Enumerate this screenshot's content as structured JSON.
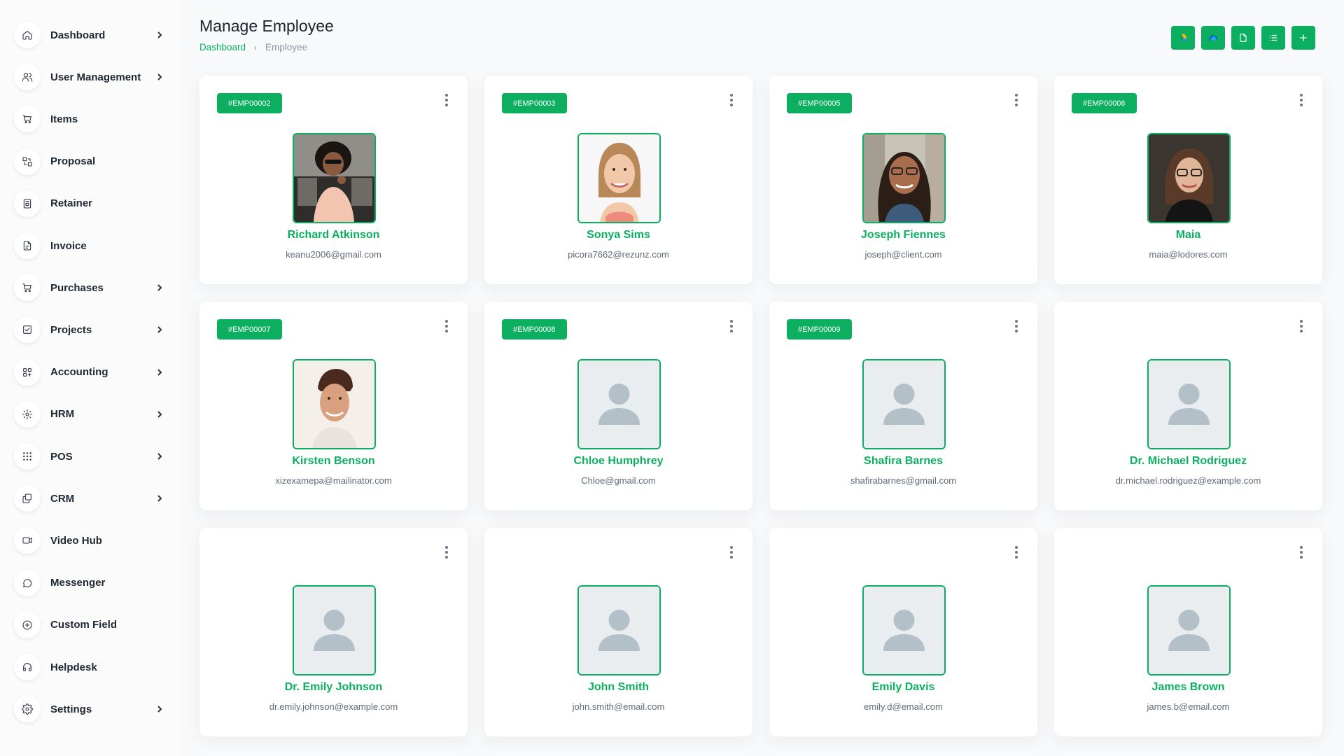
{
  "sidebar": {
    "items": [
      {
        "label": "Dashboard",
        "icon": "home-icon",
        "chevron": true
      },
      {
        "label": "User Management",
        "icon": "users-icon",
        "chevron": true
      },
      {
        "label": "Items",
        "icon": "cart-icon",
        "chevron": false
      },
      {
        "label": "Proposal",
        "icon": "proposal-icon",
        "chevron": false
      },
      {
        "label": "Retainer",
        "icon": "retainer-icon",
        "chevron": false
      },
      {
        "label": "Invoice",
        "icon": "invoice-icon",
        "chevron": false
      },
      {
        "label": "Purchases",
        "icon": "cart-icon",
        "chevron": true
      },
      {
        "label": "Projects",
        "icon": "checkbox-icon",
        "chevron": true
      },
      {
        "label": "Accounting",
        "icon": "apps-icon",
        "chevron": true
      },
      {
        "label": "HRM",
        "icon": "hrm-icon",
        "chevron": true
      },
      {
        "label": "POS",
        "icon": "grid-dots-icon",
        "chevron": true
      },
      {
        "label": "CRM",
        "icon": "crm-icon",
        "chevron": true
      },
      {
        "label": "Video Hub",
        "icon": "video-icon",
        "chevron": false
      },
      {
        "label": "Messenger",
        "icon": "message-icon",
        "chevron": false
      },
      {
        "label": "Custom Field",
        "icon": "plus-circle-icon",
        "chevron": false
      },
      {
        "label": "Helpdesk",
        "icon": "headset-icon",
        "chevron": false
      },
      {
        "label": "Settings",
        "icon": "gear-icon",
        "chevron": true
      }
    ]
  },
  "header": {
    "title": "Manage Employee",
    "breadcrumb": {
      "link": "Dashboard",
      "current": "Employee"
    }
  },
  "actions": [
    {
      "name": "google-drive-button",
      "icon": "google-drive-icon"
    },
    {
      "name": "onedrive-button",
      "icon": "onedrive-icon"
    },
    {
      "name": "import-button",
      "icon": "file-icon"
    },
    {
      "name": "list-view-button",
      "icon": "list-icon"
    },
    {
      "name": "create-button",
      "icon": "plus-icon"
    }
  ],
  "employees": [
    {
      "id": "#EMP00002",
      "name": "Richard Atkinson",
      "email": "keanu2006@gmail.com",
      "photo": "photo-1"
    },
    {
      "id": "#EMP00003",
      "name": "Sonya Sims",
      "email": "picora7662@rezunz.com",
      "photo": "photo-2"
    },
    {
      "id": "#EMP00005",
      "name": "Joseph Fiennes",
      "email": "joseph@client.com",
      "photo": "photo-3"
    },
    {
      "id": "#EMP00006",
      "name": "Maia",
      "email": "maia@lodores.com",
      "photo": "photo-4"
    },
    {
      "id": "#EMP00007",
      "name": "Kirsten Benson",
      "email": "xizexamepa@mailinator.com",
      "photo": "photo-5"
    },
    {
      "id": "#EMP00008",
      "name": "Chloe Humphrey",
      "email": "Chloe@gmail.com",
      "photo": "placeholder"
    },
    {
      "id": "#EMP00009",
      "name": "Shafira Barnes",
      "email": "shafirabarnes@gmail.com",
      "photo": "placeholder"
    },
    {
      "id": "",
      "name": "Dr. Michael Rodriguez",
      "email": "dr.michael.rodriguez@example.com",
      "photo": "placeholder"
    },
    {
      "id": "",
      "name": "Dr. Emily Johnson",
      "email": "dr.emily.johnson@example.com",
      "photo": "placeholder"
    },
    {
      "id": "",
      "name": "John Smith",
      "email": "john.smith@email.com",
      "photo": "placeholder"
    },
    {
      "id": "",
      "name": "Emily Davis",
      "email": "emily.d@email.com",
      "photo": "placeholder"
    },
    {
      "id": "",
      "name": "James Brown",
      "email": "james.b@email.com",
      "photo": "placeholder"
    }
  ],
  "colors": {
    "accent": "#0caf60",
    "placeholder_bg": "#e9edf0",
    "placeholder_fg": "#b4c0c8"
  }
}
